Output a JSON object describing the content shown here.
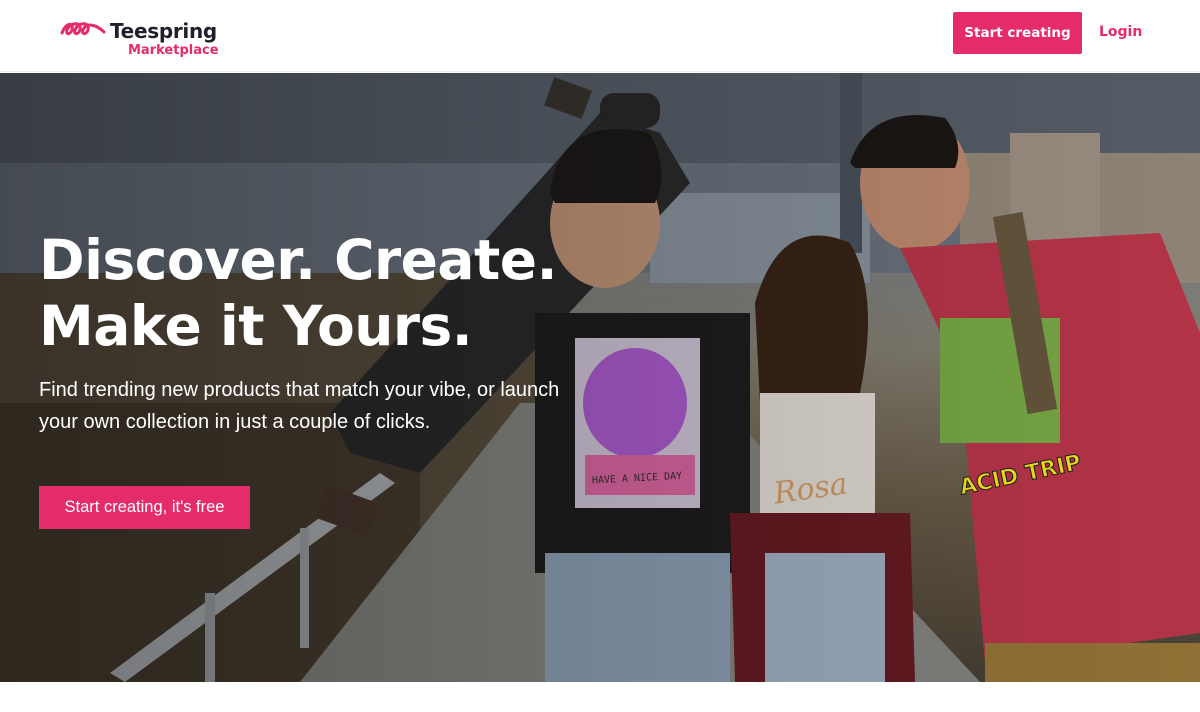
{
  "header": {
    "logo_name": "Teespring",
    "logo_sub": "Marketplace",
    "start_label": "Start creating",
    "login_label": "Login"
  },
  "hero": {
    "title_line1": "Discover. Create.",
    "title_line2": "Make it Yours.",
    "subtitle_line1": "Find trending new products that match your vibe, or launch",
    "subtitle_line2": "your own collection in just a couple of clicks.",
    "cta_label": "Start creating, it's free",
    "shirt_texts": [
      "HAVE A NICE DAY",
      "Rosa",
      "ACID TRIP"
    ]
  },
  "colors": {
    "brand": "#e62b6b",
    "dark_text": "#1f1f2e",
    "white": "#ffffff"
  },
  "icons": {
    "logo": "teespring-loops-icon"
  }
}
